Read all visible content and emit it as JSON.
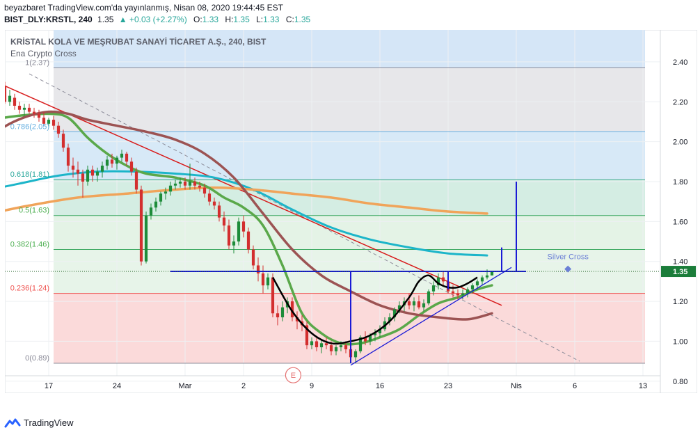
{
  "header": {
    "publisher_line": "beyazbaret TradingView.com'da yayınlanmış, Nisan 08, 2020 19:44:45 EST",
    "symbol": "BIST_DLY:KRSTL, 240",
    "last": "1.35",
    "change": "▲ +0.03 (+2.27%)",
    "o_label": "O:",
    "o_value": "1.33",
    "h_label": "H:",
    "h_value": "1.35",
    "l_label": "L:",
    "l_value": "1.33",
    "c_label": "C:",
    "c_value": "1.35"
  },
  "chart_title": "KRİSTAL KOLA VE MEŞRUBAT SANAYİ TİCARET A.Ş., 240, BIST",
  "indicator_name": "Ena Crypto Cross",
  "branding": "TradingView",
  "colors": {
    "up": "#26a69a",
    "down": "#ef5350",
    "green_candle": "#1e8c3a",
    "red_candle": "#d32f2f",
    "cyan_ma": "#1cb5c9",
    "orange_ma": "#f0a45a",
    "green_ma": "#5aa84a",
    "brown_ma": "#9c5353",
    "blue_lines": "#1a1ad6",
    "red_trend": "#d81b1b"
  },
  "chart_data": {
    "type": "candlestick",
    "y_axis": {
      "min": 0.74,
      "max": 2.56,
      "ticks": [
        "2.40",
        "2.20",
        "2.00",
        "1.80",
        "1.60",
        "1.40",
        "1.20",
        "1.00",
        "0.80"
      ],
      "current_price_label": "1.35"
    },
    "x_axis": {
      "ticks": [
        "17",
        "24",
        "Mar",
        "2",
        "9",
        "16",
        "23",
        "Nis",
        "6",
        "13"
      ],
      "tick_values": [
        17,
        24,
        31,
        37,
        44,
        51,
        58,
        65,
        71,
        78
      ]
    },
    "fib_levels": [
      {
        "level": "1",
        "value": 2.37,
        "label": "1(2.37)"
      },
      {
        "level": "0.786",
        "value": 2.05,
        "label": "0.786(2.05)"
      },
      {
        "level": "0.618",
        "value": 1.81,
        "label": "0.618(1.81)"
      },
      {
        "level": "0.5",
        "value": 1.63,
        "label": "0.5(1.63)"
      },
      {
        "level": "0.382",
        "value": 1.46,
        "label": "0.382(1.46)"
      },
      {
        "level": "0.236",
        "value": 1.24,
        "label": "0.236(1.24)"
      },
      {
        "level": "0",
        "value": 0.89,
        "label": "0(0.89)"
      }
    ],
    "annotations": [
      {
        "text": "Silver Cross",
        "x": 70.3,
        "y": 1.39
      },
      {
        "text": "E",
        "x": 42.1,
        "y": 0.83
      }
    ],
    "candles": [
      [
        11.0,
        2.18,
        2.26,
        2.16,
        2.24
      ],
      [
        11.5,
        2.25,
        2.33,
        2.23,
        2.31
      ],
      [
        12.0,
        2.31,
        2.37,
        2.26,
        2.28
      ],
      [
        12.5,
        2.28,
        2.3,
        2.19,
        2.2
      ],
      [
        13.0,
        2.2,
        2.26,
        2.18,
        2.23
      ],
      [
        13.5,
        2.22,
        2.24,
        2.16,
        2.18
      ],
      [
        14.0,
        2.18,
        2.2,
        2.14,
        2.16
      ],
      [
        14.5,
        2.16,
        2.19,
        2.13,
        2.17
      ],
      [
        15.0,
        2.17,
        2.19,
        2.14,
        2.15
      ],
      [
        15.5,
        2.15,
        2.17,
        2.12,
        2.14
      ],
      [
        16.0,
        2.14,
        2.16,
        2.1,
        2.12
      ],
      [
        16.5,
        2.12,
        2.15,
        2.08,
        2.09
      ],
      [
        17.0,
        2.09,
        2.12,
        2.07,
        2.11
      ],
      [
        17.5,
        2.11,
        2.13,
        2.06,
        2.08
      ],
      [
        18.0,
        2.08,
        2.1,
        2.02,
        2.04
      ],
      [
        18.5,
        2.04,
        2.06,
        1.95,
        1.97
      ],
      [
        19.0,
        1.97,
        1.99,
        1.85,
        1.88
      ],
      [
        19.5,
        1.88,
        1.92,
        1.82,
        1.86
      ],
      [
        20.0,
        1.86,
        1.9,
        1.78,
        1.84
      ],
      [
        20.5,
        1.84,
        1.86,
        1.72,
        1.8
      ],
      [
        21.0,
        1.8,
        1.88,
        1.78,
        1.86
      ],
      [
        21.5,
        1.86,
        1.88,
        1.8,
        1.83
      ],
      [
        22.0,
        1.83,
        1.87,
        1.8,
        1.85
      ],
      [
        22.5,
        1.85,
        1.9,
        1.82,
        1.88
      ],
      [
        23.0,
        1.88,
        1.93,
        1.86,
        1.91
      ],
      [
        23.5,
        1.91,
        1.94,
        1.87,
        1.89
      ],
      [
        24.0,
        1.89,
        1.93,
        1.86,
        1.92
      ],
      [
        24.5,
        1.92,
        1.96,
        1.9,
        1.94
      ],
      [
        25.0,
        1.94,
        1.95,
        1.88,
        1.9
      ],
      [
        25.5,
        1.9,
        1.92,
        1.83,
        1.85
      ],
      [
        26.0,
        1.85,
        1.87,
        1.74,
        1.76
      ],
      [
        26.5,
        1.76,
        1.78,
        1.38,
        1.4
      ],
      [
        27.0,
        1.4,
        1.65,
        1.39,
        1.63
      ],
      [
        27.5,
        1.63,
        1.69,
        1.61,
        1.67
      ],
      [
        28.0,
        1.67,
        1.72,
        1.65,
        1.7
      ],
      [
        28.5,
        1.7,
        1.75,
        1.68,
        1.74
      ],
      [
        29.0,
        1.74,
        1.77,
        1.71,
        1.75
      ],
      [
        29.5,
        1.75,
        1.8,
        1.73,
        1.78
      ],
      [
        30.0,
        1.78,
        1.81,
        1.76,
        1.79
      ],
      [
        30.5,
        1.79,
        1.82,
        1.77,
        1.8
      ],
      [
        31.0,
        1.8,
        1.82,
        1.76,
        1.78
      ],
      [
        31.5,
        1.78,
        1.89,
        1.76,
        1.8
      ],
      [
        32.0,
        1.8,
        1.82,
        1.76,
        1.78
      ],
      [
        32.5,
        1.78,
        1.8,
        1.75,
        1.77
      ],
      [
        33.0,
        1.77,
        1.79,
        1.72,
        1.74
      ],
      [
        33.5,
        1.74,
        1.76,
        1.68,
        1.7
      ],
      [
        34.0,
        1.7,
        1.72,
        1.66,
        1.68
      ],
      [
        34.5,
        1.68,
        1.7,
        1.6,
        1.62
      ],
      [
        35.0,
        1.62,
        1.65,
        1.55,
        1.58
      ],
      [
        35.5,
        1.58,
        1.61,
        1.46,
        1.48
      ],
      [
        36.0,
        1.48,
        1.53,
        1.44,
        1.5
      ],
      [
        36.5,
        1.5,
        1.62,
        1.48,
        1.6
      ],
      [
        37.0,
        1.6,
        1.63,
        1.52,
        1.55
      ],
      [
        37.5,
        1.55,
        1.57,
        1.44,
        1.46
      ],
      [
        38.0,
        1.46,
        1.48,
        1.36,
        1.38
      ],
      [
        38.5,
        1.38,
        1.42,
        1.3,
        1.34
      ],
      [
        39.0,
        1.34,
        1.38,
        1.24,
        1.28
      ],
      [
        39.5,
        1.28,
        1.34,
        1.26,
        1.32
      ],
      [
        40.0,
        1.32,
        1.34,
        1.12,
        1.14
      ],
      [
        40.5,
        1.14,
        1.18,
        1.08,
        1.12
      ],
      [
        41.0,
        1.12,
        1.2,
        1.1,
        1.17
      ],
      [
        41.5,
        1.17,
        1.22,
        1.14,
        1.2
      ],
      [
        42.0,
        1.2,
        1.22,
        1.1,
        1.12
      ],
      [
        42.5,
        1.12,
        1.15,
        1.06,
        1.1
      ],
      [
        43.0,
        1.1,
        1.13,
        1.05,
        1.08
      ],
      [
        43.5,
        1.08,
        1.1,
        0.96,
        0.98
      ],
      [
        44.0,
        0.98,
        1.02,
        0.96,
        1.0
      ],
      [
        44.5,
        1.0,
        1.02,
        0.95,
        0.97
      ],
      [
        45.0,
        0.97,
        1.01,
        0.94,
        0.99
      ],
      [
        45.5,
        0.99,
        1.02,
        0.96,
        0.98
      ],
      [
        46.0,
        0.98,
        1.0,
        0.93,
        0.95
      ],
      [
        46.5,
        0.95,
        0.98,
        0.93,
        0.97
      ],
      [
        47.0,
        0.97,
        1.0,
        0.95,
        0.98
      ],
      [
        47.5,
        0.98,
        1.0,
        0.94,
        0.96
      ],
      [
        48.0,
        0.96,
        0.98,
        0.9,
        0.92
      ],
      [
        48.5,
        0.92,
        0.96,
        0.89,
        0.95
      ],
      [
        49.0,
        0.95,
        1.03,
        0.94,
        1.02
      ],
      [
        49.5,
        1.02,
        1.05,
        0.98,
        1.0
      ],
      [
        50.0,
        1.0,
        1.04,
        0.98,
        1.03
      ],
      [
        50.5,
        1.03,
        1.06,
        1.0,
        1.04
      ],
      [
        51.0,
        1.04,
        1.08,
        1.02,
        1.06
      ],
      [
        51.5,
        1.06,
        1.12,
        1.05,
        1.1
      ],
      [
        52.0,
        1.1,
        1.14,
        1.08,
        1.12
      ],
      [
        52.5,
        1.12,
        1.17,
        1.1,
        1.16
      ],
      [
        53.0,
        1.16,
        1.2,
        1.14,
        1.18
      ],
      [
        53.5,
        1.18,
        1.22,
        1.15,
        1.2
      ],
      [
        54.0,
        1.2,
        1.24,
        1.16,
        1.18
      ],
      [
        54.5,
        1.18,
        1.22,
        1.15,
        1.2
      ],
      [
        55.0,
        1.2,
        1.23,
        1.16,
        1.17
      ],
      [
        55.5,
        1.17,
        1.21,
        1.15,
        1.19
      ],
      [
        56.0,
        1.19,
        1.26,
        1.18,
        1.25
      ],
      [
        56.5,
        1.25,
        1.3,
        1.23,
        1.28
      ],
      [
        57.0,
        1.28,
        1.34,
        1.26,
        1.32
      ],
      [
        57.5,
        1.32,
        1.35,
        1.28,
        1.3
      ],
      [
        58.0,
        1.3,
        1.32,
        1.24,
        1.25
      ],
      [
        58.5,
        1.25,
        1.28,
        1.22,
        1.24
      ],
      [
        59.0,
        1.24,
        1.26,
        1.21,
        1.23
      ],
      [
        59.5,
        1.23,
        1.26,
        1.21,
        1.24
      ],
      [
        60.0,
        1.24,
        1.27,
        1.22,
        1.26
      ],
      [
        60.5,
        1.26,
        1.29,
        1.24,
        1.28
      ],
      [
        61.0,
        1.28,
        1.31,
        1.26,
        1.3
      ],
      [
        61.5,
        1.3,
        1.33,
        1.28,
        1.32
      ],
      [
        62.0,
        1.32,
        1.36,
        1.31,
        1.33
      ],
      [
        62.5,
        1.33,
        1.35,
        1.33,
        1.35
      ]
    ],
    "moving_averages": [
      {
        "name": "cyan",
        "points": [
          [
            11,
            1.76
          ],
          [
            14,
            1.79
          ],
          [
            18,
            1.83
          ],
          [
            22,
            1.85
          ],
          [
            26,
            1.85
          ],
          [
            30,
            1.84
          ],
          [
            34,
            1.82
          ],
          [
            38,
            1.76
          ],
          [
            42,
            1.66
          ],
          [
            46,
            1.57
          ],
          [
            50,
            1.51
          ],
          [
            54,
            1.47
          ],
          [
            58,
            1.44
          ],
          [
            62,
            1.43
          ]
        ]
      },
      {
        "name": "orange",
        "points": [
          [
            11,
            1.64
          ],
          [
            15,
            1.68
          ],
          [
            20,
            1.72
          ],
          [
            25,
            1.74
          ],
          [
            30,
            1.76
          ],
          [
            34,
            1.77
          ],
          [
            38,
            1.76
          ],
          [
            42,
            1.74
          ],
          [
            46,
            1.72
          ],
          [
            50,
            1.69
          ],
          [
            54,
            1.67
          ],
          [
            58,
            1.65
          ],
          [
            62,
            1.64
          ]
        ]
      },
      {
        "name": "green",
        "points": [
          [
            11,
            2.11
          ],
          [
            14,
            2.13
          ],
          [
            17,
            2.14
          ],
          [
            19,
            2.12
          ],
          [
            21,
            2.02
          ],
          [
            23,
            1.94
          ],
          [
            25,
            1.88
          ],
          [
            27,
            1.84
          ],
          [
            30,
            1.82
          ],
          [
            33,
            1.78
          ],
          [
            35,
            1.72
          ],
          [
            37,
            1.67
          ],
          [
            39,
            1.58
          ],
          [
            41,
            1.38
          ],
          [
            43,
            1.14
          ],
          [
            45,
            1.04
          ],
          [
            47,
            0.99
          ],
          [
            49,
            0.99
          ],
          [
            51,
            1.02
          ],
          [
            53,
            1.06
          ],
          [
            55,
            1.13
          ],
          [
            57,
            1.19
          ],
          [
            59,
            1.22
          ],
          [
            61,
            1.26
          ],
          [
            62.5,
            1.28
          ]
        ]
      },
      {
        "name": "brown",
        "points": [
          [
            11,
            2.03
          ],
          [
            13,
            2.09
          ],
          [
            15,
            2.13
          ],
          [
            17,
            2.15
          ],
          [
            19,
            2.14
          ],
          [
            21,
            2.11
          ],
          [
            24,
            2.08
          ],
          [
            27,
            2.05
          ],
          [
            30,
            2.01
          ],
          [
            33,
            1.94
          ],
          [
            36,
            1.82
          ],
          [
            39,
            1.64
          ],
          [
            42,
            1.46
          ],
          [
            45,
            1.33
          ],
          [
            48,
            1.25
          ],
          [
            51,
            1.18
          ],
          [
            54,
            1.14
          ],
          [
            57,
            1.12
          ],
          [
            60,
            1.11
          ],
          [
            62.5,
            1.14
          ]
        ]
      }
    ],
    "drawings": {
      "red_trend": [
        [
          12,
          2.29
        ],
        [
          63.5,
          1.18
        ]
      ],
      "dashed_trend": [
        [
          15,
          2.34
        ],
        [
          71.5,
          0.9
        ]
      ],
      "neckline": [
        [
          29.5,
          1.35
        ],
        [
          66,
          1.35
        ]
      ],
      "support_line": [
        [
          48,
          0.88
        ],
        [
          64.5,
          1.37
        ]
      ],
      "black_arc": [
        [
          40,
          1.32
        ],
        [
          42,
          1.15
        ],
        [
          44,
          1.04
        ],
        [
          46,
          0.99
        ],
        [
          48,
          1.0
        ],
        [
          50,
          1.03
        ],
        [
          52,
          1.1
        ],
        [
          54,
          1.22
        ],
        [
          55,
          1.3
        ],
        [
          56,
          1.33
        ],
        [
          57,
          1.29
        ],
        [
          58,
          1.27
        ],
        [
          59,
          1.27
        ],
        [
          60,
          1.29
        ],
        [
          61,
          1.32
        ]
      ],
      "blue_vertical": [
        [
          48,
          0.89
        ],
        [
          48,
          1.35
        ]
      ],
      "blue_vertical_2": [
        [
          65,
          1.35
        ],
        [
          65,
          1.8
        ]
      ],
      "blue_vertical_3": [
        [
          63.5,
          1.35
        ],
        [
          63.5,
          1.47
        ]
      ],
      "blue_vertical_4": [
        [
          58,
          1.26
        ],
        [
          58,
          1.35
        ]
      ]
    }
  }
}
